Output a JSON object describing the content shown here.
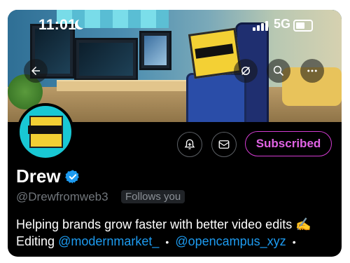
{
  "status_bar": {
    "time": "11:01",
    "network": "5G"
  },
  "profile": {
    "name": "Drew",
    "handle": "@Drewfromweb3",
    "follows_you": "Follows you",
    "subscribe_label": "Subscribed",
    "bio_line1": "Helping brands grow faster with better video edits",
    "bio_emoji": "✍️",
    "bio_prefix": "Editing",
    "mention1": "@modernmarket_",
    "separator": "•",
    "mention2": "@opencampus_xyz",
    "trailing": "•"
  },
  "colors": {
    "accent": "#1d9bf0",
    "subscribed": "#e063e4",
    "background": "#000000"
  },
  "icons": [
    "back-arrow-icon",
    "mute-icon",
    "search-icon",
    "more-icon",
    "notification-add-icon",
    "mail-icon",
    "verified-icon"
  ]
}
